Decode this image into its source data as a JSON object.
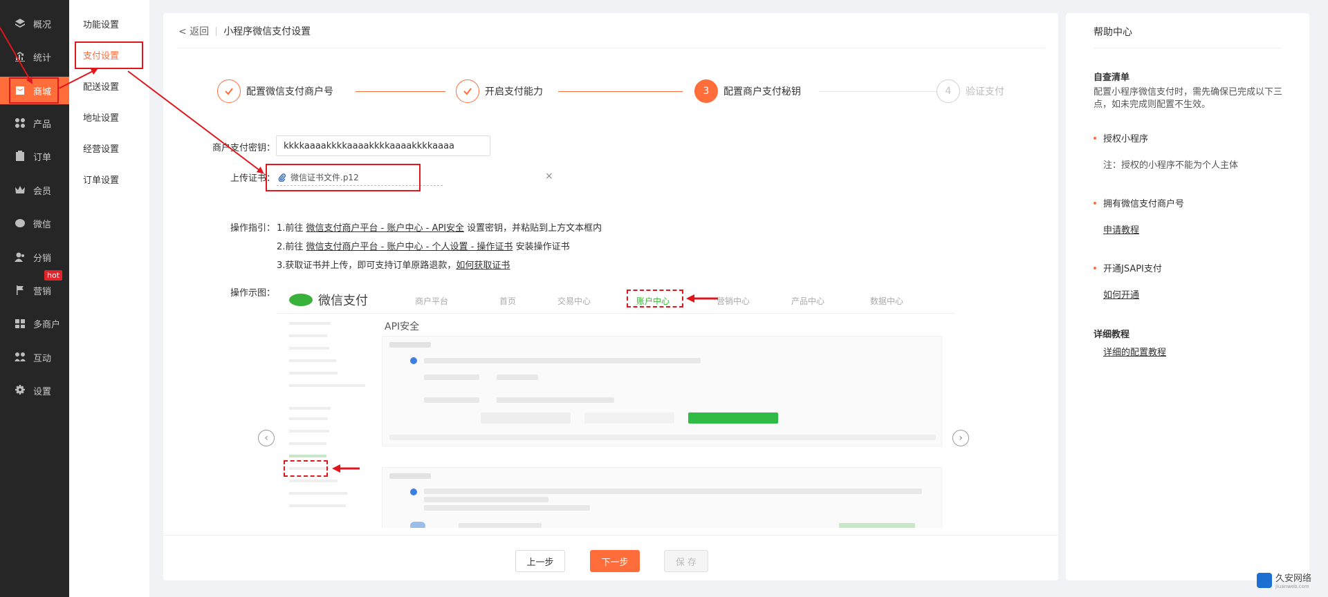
{
  "sidebar": {
    "items": [
      {
        "label": "概况",
        "icon": "layers-icon"
      },
      {
        "label": "统计",
        "icon": "chart-icon"
      },
      {
        "label": "商城",
        "icon": "shop-icon"
      },
      {
        "label": "产品",
        "icon": "grid-icon"
      },
      {
        "label": "订单",
        "icon": "clipboard-icon"
      },
      {
        "label": "会员",
        "icon": "crown-icon"
      },
      {
        "label": "微信",
        "icon": "wechat-icon"
      },
      {
        "label": "分销",
        "icon": "users-icon"
      },
      {
        "label": "营销",
        "icon": "flag-icon"
      },
      {
        "label": "多商户",
        "icon": "store-icon"
      },
      {
        "label": "互动",
        "icon": "interact-icon"
      },
      {
        "label": "设置",
        "icon": "gear-icon"
      }
    ],
    "hot_badge": "hot",
    "active_color": "#ff6d3b"
  },
  "subnav": {
    "items": [
      "功能设置",
      "支付设置",
      "配送设置",
      "地址设置",
      "经营设置",
      "订单设置"
    ]
  },
  "breadcrumb": {
    "back": "< 返回",
    "title": "小程序微信支付设置"
  },
  "steps": [
    {
      "label": "配置微信支付商户号",
      "state": "done"
    },
    {
      "label": "开启支付能力",
      "state": "done"
    },
    {
      "label": "配置商户支付秘钥",
      "state": "current",
      "num": "3"
    },
    {
      "label": "验证支付",
      "state": "todo",
      "num": "4"
    }
  ],
  "form": {
    "key_label": "商户支付密钥：",
    "key_value": "kkkkaaaakkkkaaaakkkkaaaakkkkaaaa",
    "cert_label": "上传证书：",
    "cert_file": "微信证书文件.p12",
    "cert_remove": "×"
  },
  "guide": {
    "label": "操作指引：",
    "line1_prefix": "1.前往",
    "line1_link": "微信支付商户平台 - 账户中心 - API安全",
    "line1_suffix": "设置密钥，并粘贴到上方文本框内",
    "line2_prefix": "2.前往",
    "line2_link": "微信支付商户平台 - 账户中心 - 个人设置 - 操作证书",
    "line2_suffix": "安装操作证书",
    "line3_prefix": "3.获取证书并上传，即可支持订单原路退款，",
    "line3_link": "如何获取证书",
    "example_label": "操作示图："
  },
  "example": {
    "logo": "微信支付",
    "nav": [
      "商户平台",
      "首页",
      "交易中心",
      "账户中心",
      "营销中心",
      "产品中心",
      "数据中心"
    ],
    "section": "API安全",
    "prev": "‹",
    "next": "›"
  },
  "footer": {
    "prev": "上一步",
    "next": "下一步",
    "save": "保 存"
  },
  "help": {
    "title": "帮助中心",
    "checklist_title": "自查清单",
    "checklist_desc": "配置小程序微信支付时，需先确保已完成以下三点，如未完成则配置不生效。",
    "item1": "授权小程序",
    "item1_note": "注：授权的小程序不能为个人主体",
    "item2": "拥有微信支付商户号",
    "item2_link": "申请教程",
    "item3": "开通JSAPI支付",
    "item3_link": "如何开通",
    "tutorial_title": "详细教程",
    "tutorial_link": "详细的配置教程"
  },
  "watermark": {
    "name": "久安网络",
    "domain": "jiuanweb.com"
  }
}
